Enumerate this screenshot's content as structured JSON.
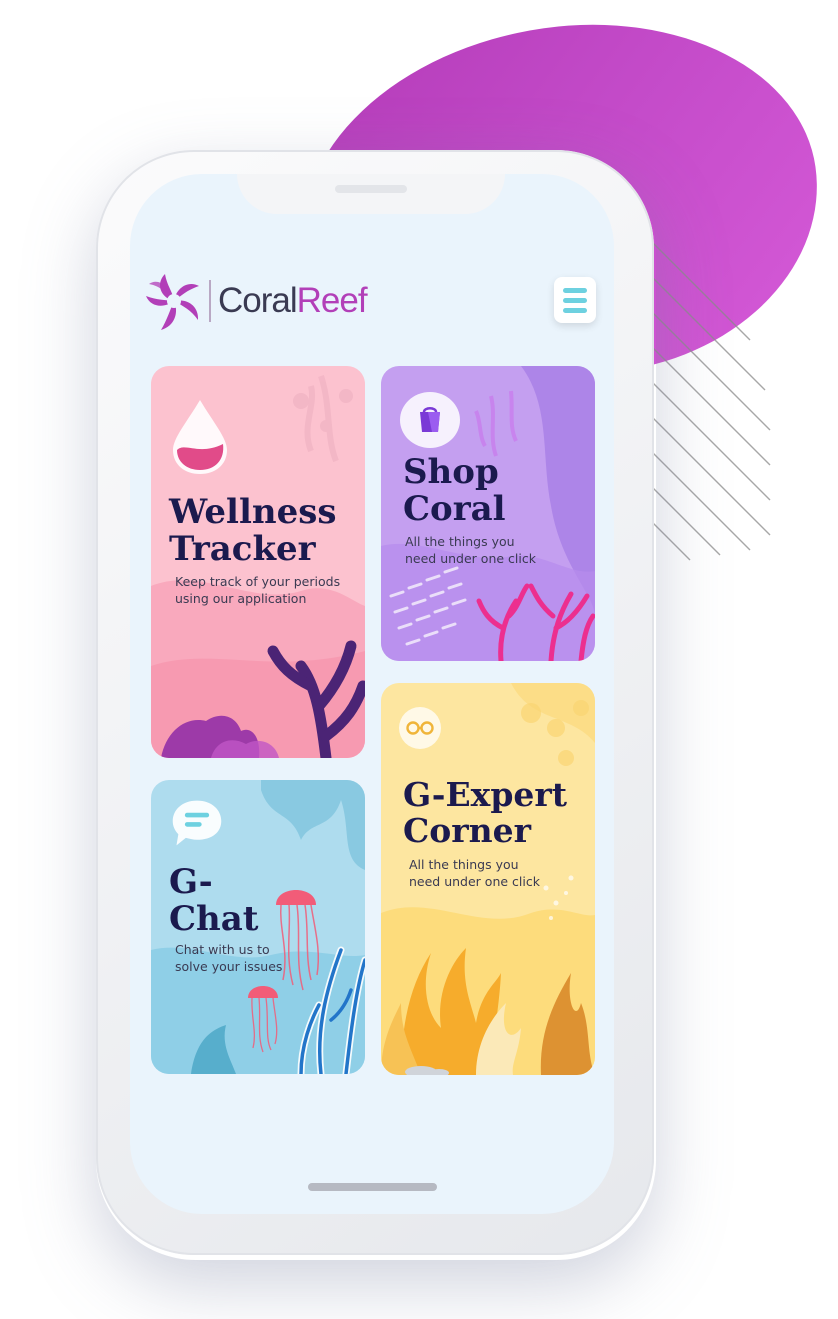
{
  "app": {
    "brand_part1": "Coral",
    "brand_part2": "Reef",
    "logo_icon": "coral-shell-logo",
    "menu_icon": "hamburger-menu-icon"
  },
  "colors": {
    "brand_purple": "#b23fb8",
    "navy_text": "#1b1a4e",
    "wellness_card": "#fcc2cf",
    "shop_card": "#c49ff0",
    "chat_card": "#aedcee",
    "expert_card": "#fde6a0",
    "menu_accent": "#6ed1e0"
  },
  "cards": {
    "wellness": {
      "title_line1": "Wellness",
      "title_line2": "Tracker",
      "sub_line1": "Keep track of your periods",
      "sub_line2": "using our application",
      "icon": "water-drop-icon"
    },
    "shop": {
      "title_line1": "Shop",
      "title_line2": "Coral",
      "sub_line1": "All the things you",
      "sub_line2": "need under one click",
      "icon": "shopping-bag-icon"
    },
    "chat": {
      "title_line1": "G-",
      "title_line2": "Chat",
      "sub_line1": "Chat with us to",
      "sub_line2": "solve your issues",
      "icon": "chat-bubble-icon"
    },
    "expert": {
      "title_line1": "G-Expert",
      "title_line2": "Corner",
      "sub_line1": "All the things you",
      "sub_line2": "need under one click",
      "icon": "glasses-icon"
    }
  }
}
